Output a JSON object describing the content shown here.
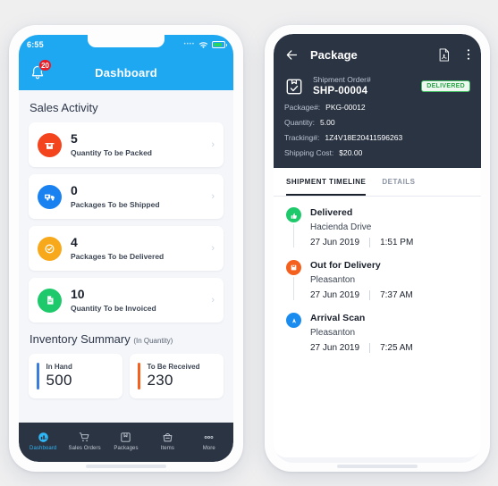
{
  "left_phone": {
    "status_bar": {
      "time": "6:55",
      "wifi_icon": "wifi-icon",
      "battery_icon": "battery-icon"
    },
    "app_bar": {
      "title": "Dashboard",
      "bell_icon": "bell-icon",
      "notification_count": "20"
    },
    "sales_activity": {
      "heading": "Sales Activity",
      "cards": [
        {
          "value": "5",
          "label": "Quantity To be Packed",
          "icon": "package-box-icon",
          "color": "#f4441e"
        },
        {
          "value": "0",
          "label": "Packages To be Shipped",
          "icon": "truck-icon",
          "color": "#1a82f0"
        },
        {
          "value": "4",
          "label": "Packages To be Delivered",
          "icon": "check-circle-icon",
          "color": "#f7a81b"
        },
        {
          "value": "10",
          "label": "Quantity To be Invoiced",
          "icon": "document-icon",
          "color": "#1ec96b"
        }
      ]
    },
    "inventory_summary": {
      "heading": "Inventory Summary",
      "heading_suffix": "(In Quantity)",
      "cards": [
        {
          "label": "In Hand",
          "value": "500",
          "color": "#3b7ddd"
        },
        {
          "label": "To Be Received",
          "value": "230",
          "color": "#f4601e"
        }
      ]
    },
    "bottom_nav": {
      "items": [
        {
          "label": "Dashboard",
          "icon": "dashboard-icon",
          "active": true
        },
        {
          "label": "Sales Orders",
          "icon": "cart-icon",
          "active": false
        },
        {
          "label": "Packages",
          "icon": "package-icon",
          "active": false
        },
        {
          "label": "Items",
          "icon": "basket-icon",
          "active": false
        },
        {
          "label": "More",
          "icon": "more-dots-icon",
          "active": false
        }
      ]
    }
  },
  "right_phone": {
    "header": {
      "back_icon": "back-arrow-icon",
      "title": "Package",
      "pdf_icon": "pdf-document-icon",
      "menu_icon": "overflow-menu-icon",
      "shipment_icon": "shipment-box-check-icon",
      "shipment_order_label": "Shipment Order#",
      "shipment_order_value": "SHP-00004",
      "status_badge": "DELIVERED",
      "fields": [
        {
          "key": "Package#:",
          "value": "PKG-00012"
        },
        {
          "key": "Quantity:",
          "value": "5.00"
        },
        {
          "key": "Tracking#:",
          "value": "1Z4V18E20411596263"
        },
        {
          "key": "Shipping Cost:",
          "value": "$20.00"
        }
      ]
    },
    "tabs": [
      {
        "label": "SHIPMENT TIMELINE",
        "active": true
      },
      {
        "label": "DETAILS",
        "active": false
      }
    ],
    "timeline": [
      {
        "title": "Delivered",
        "location": "Hacienda Drive",
        "date": "27 Jun 2019",
        "time": "1:51 PM",
        "icon": "thumbs-up-icon",
        "color": "#1ec96b"
      },
      {
        "title": "Out for Delivery",
        "location": "Pleasanton",
        "date": "27 Jun 2019",
        "time": "7:37 AM",
        "icon": "package-out-icon",
        "color": "#f4601e"
      },
      {
        "title": "Arrival Scan",
        "location": "Pleasanton",
        "date": "27 Jun 2019",
        "time": "7:25 AM",
        "icon": "arrival-arrow-icon",
        "color": "#1a8cf0"
      }
    ]
  }
}
